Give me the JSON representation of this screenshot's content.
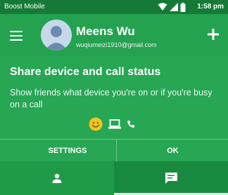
{
  "status_bar": {
    "carrier": "Boost Mobile",
    "time": "1:58 pm",
    "icons": [
      "wifi-icon",
      "signal-icon",
      "battery-icon"
    ]
  },
  "header": {
    "user_name": "Meens Wu",
    "user_email": "wuqiumeizi1910@gmail.com",
    "icons": [
      "menu-icon",
      "avatar",
      "plus-icon"
    ]
  },
  "card": {
    "title": "Share device and call status",
    "description": "Show friends what device you're on or if you're busy on a call",
    "indicator_icons": [
      "smiley-icon",
      "laptop-icon",
      "phone-icon"
    ]
  },
  "actions": {
    "settings_label": "SETTINGS",
    "ok_label": "OK"
  },
  "bottom_nav": {
    "tabs": [
      {
        "icon": "person-icon",
        "selected": false
      },
      {
        "icon": "chat-icon",
        "selected": true
      }
    ]
  },
  "colors": {
    "status_bar": "#157a37",
    "app_bar": "#24a24f",
    "card": "#27a654",
    "smiley": "#f5c518"
  }
}
